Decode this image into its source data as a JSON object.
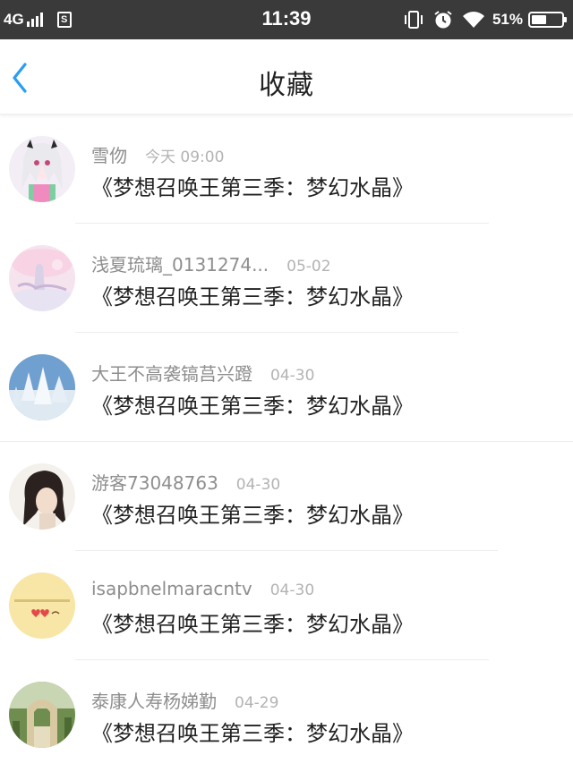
{
  "status_bar": {
    "network": "4G",
    "time": "11:39",
    "battery_text": "51%",
    "battery_level": 0.51,
    "icons": [
      "signal-icon",
      "sim-icon",
      "vibrate-icon",
      "alarm-icon",
      "wifi-icon",
      "battery-icon"
    ]
  },
  "header": {
    "title": "收藏",
    "back_icon": "chevron-left-icon",
    "accent_color": "#2a9df4"
  },
  "favorites": [
    {
      "username": "雪伆",
      "time": "今天 09:00",
      "title": "《梦想召唤王第三季：梦幻水晶》",
      "avatar": "anime-girl-avatar"
    },
    {
      "username": "浅夏琉璃_0131274...",
      "time": "05-02",
      "title": "《梦想召唤王第三季：梦幻水晶》",
      "avatar": "pink-scene-avatar"
    },
    {
      "username": "大王不高袭镐莒兴蹬",
      "time": "04-30",
      "title": "《梦想召唤王第三季：梦幻水晶》",
      "avatar": "snow-trees-avatar"
    },
    {
      "username": "游客73048763",
      "time": "04-30",
      "title": "《梦想召唤王第三季：梦幻水晶》",
      "avatar": "dark-hair-avatar"
    },
    {
      "username": "isapbnelmaracntv",
      "time": "04-30",
      "title": "《梦想召唤王第三季：梦幻水晶》",
      "avatar": "yellow-text-avatar"
    },
    {
      "username": "泰康人寿杨娣勤",
      "time": "04-29",
      "title": "《梦想召唤王第三季：梦幻水晶》",
      "avatar": "garden-arch-avatar"
    }
  ]
}
